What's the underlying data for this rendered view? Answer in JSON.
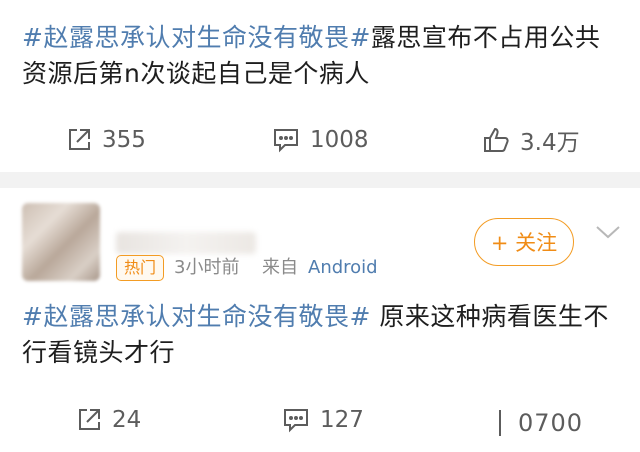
{
  "post1": {
    "tag": "#赵露思承认对生命没有敬畏#",
    "text": "露思宣布不占用公共资源后第n次谈起自己是个病人",
    "repost_count": "355",
    "comment_count": "1008",
    "like_count": "3.4万"
  },
  "post2": {
    "badge": "热门",
    "time": "3小时前",
    "source_prefix": "来自",
    "source_app": "Android",
    "follow_label": "+ 关注",
    "tag": "#赵露思承认对生命没有敬畏#",
    "text": " 原来这种病看医生不行看镜头才行",
    "repost_count": "24",
    "comment_count": "127",
    "like_count": "0700"
  },
  "colors": {
    "link": "#507daf",
    "accent": "#f39c24",
    "text": "#1e1e1e",
    "muted": "#8a8a8a"
  }
}
